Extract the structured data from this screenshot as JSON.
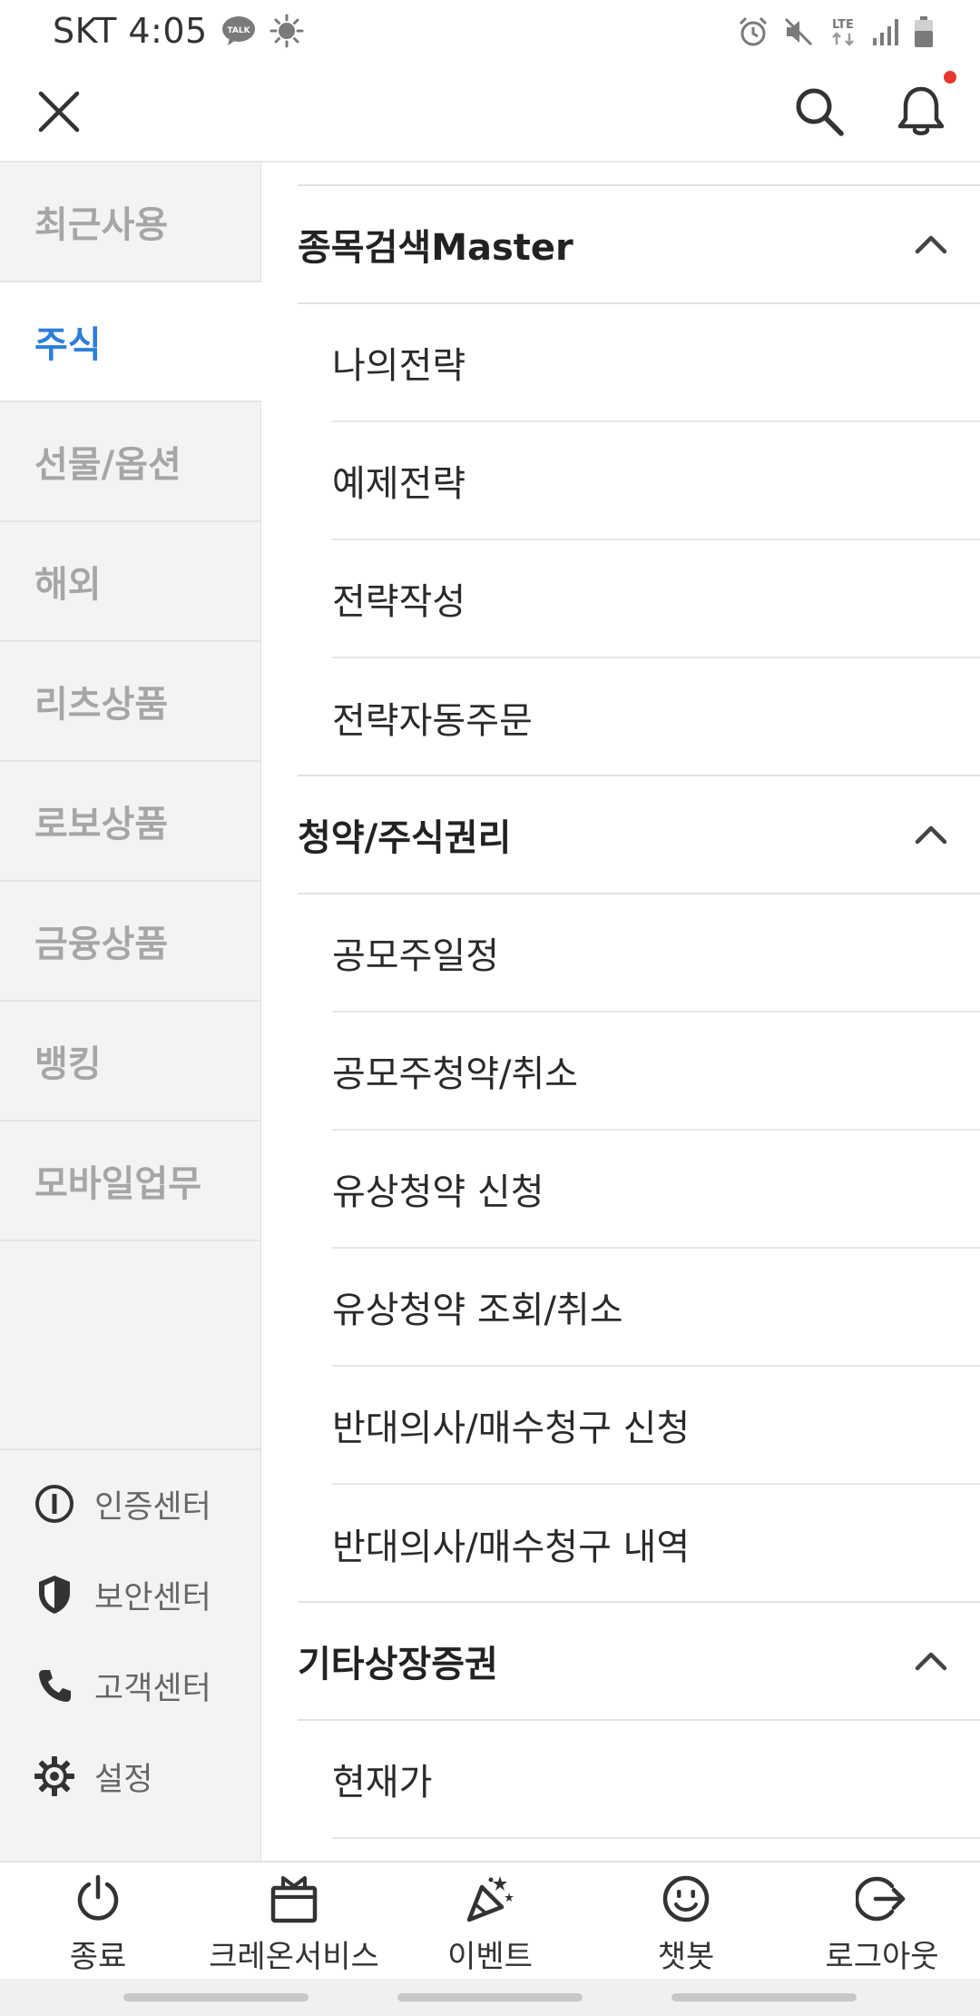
{
  "status_bar": {
    "carrier_time": "SKT 4:05",
    "kakao_badge": "TALK",
    "network": "LTE"
  },
  "header": {
    "close_icon": "close-icon",
    "search_icon": "search-icon",
    "bell_icon": "bell-icon",
    "notification_dot_color": "#e8352e"
  },
  "categories": [
    {
      "label": "최근사용",
      "active": false
    },
    {
      "label": "주식",
      "active": true
    },
    {
      "label": "선물/옵션",
      "active": false
    },
    {
      "label": "해외",
      "active": false
    },
    {
      "label": "리츠상품",
      "active": false
    },
    {
      "label": "로보상품",
      "active": false
    },
    {
      "label": "금융상품",
      "active": false
    },
    {
      "label": "뱅킹",
      "active": false
    },
    {
      "label": "모바일업무",
      "active": false
    }
  ],
  "utilities": [
    {
      "label": "인증센터",
      "icon": "info-circle-icon"
    },
    {
      "label": "보안센터",
      "icon": "shield-icon"
    },
    {
      "label": "고객센터",
      "icon": "phone-icon"
    },
    {
      "label": "설정",
      "icon": "gear-icon"
    }
  ],
  "menu": {
    "sections": [
      {
        "title": "종목검색Master",
        "expanded": true,
        "items": [
          "나의전략",
          "예제전략",
          "전략작성",
          "전략자동주문"
        ]
      },
      {
        "title": "청약/주식권리",
        "expanded": true,
        "items": [
          "공모주일정",
          "공모주청약/취소",
          "유상청약 신청",
          "유상청약 조회/취소",
          "반대의사/매수청구 신청",
          "반대의사/매수청구 내역"
        ]
      },
      {
        "title": "기타상장증권",
        "expanded": true,
        "items": [
          "현재가"
        ]
      }
    ]
  },
  "bottom_bar": [
    {
      "label": "종료",
      "icon": "power-icon"
    },
    {
      "label": "크레온서비스",
      "icon": "gift-box-icon"
    },
    {
      "label": "이벤트",
      "icon": "party-popper-icon"
    },
    {
      "label": "챗봇",
      "icon": "smiley-icon"
    },
    {
      "label": "로그아웃",
      "icon": "logout-icon"
    }
  ],
  "colors": {
    "accent": "#2e7fd9",
    "inactive_category": "#a6a6a6",
    "left_panel_bg": "#f3f3f3",
    "notification": "#e8352e"
  }
}
